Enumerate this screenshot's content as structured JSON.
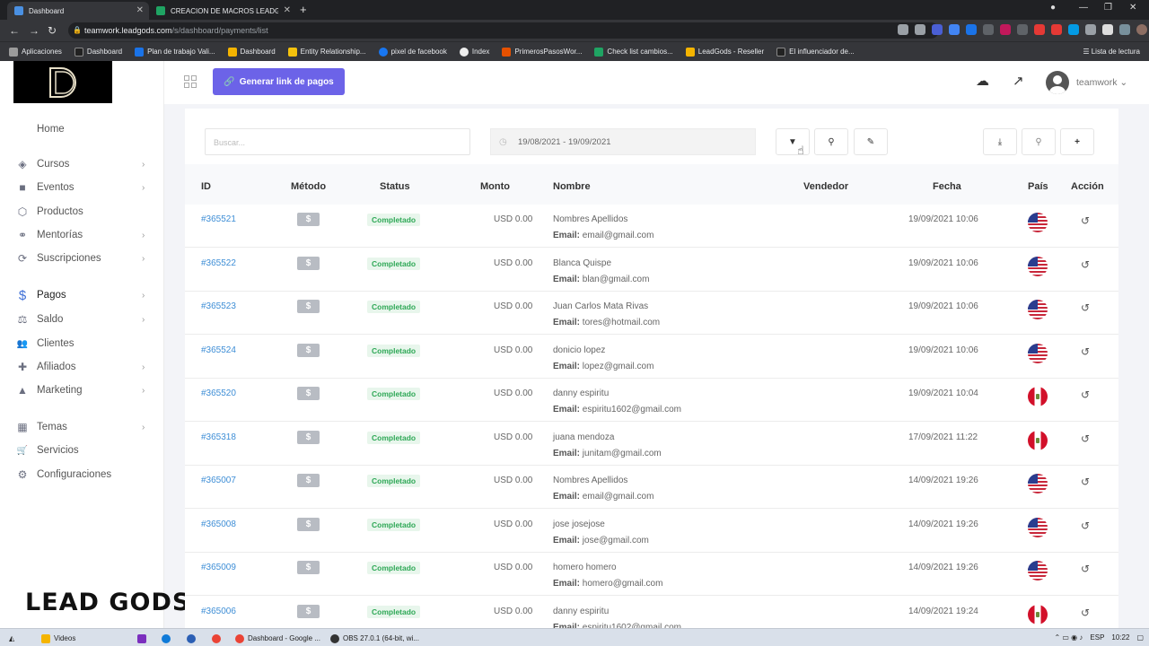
{
  "browser": {
    "tabs": [
      {
        "title": "Dashboard",
        "active": true,
        "color": "#4a90e2"
      },
      {
        "title": "CREACION DE MACROS LEADGO...",
        "active": false,
        "color": "#1fa463"
      }
    ],
    "url_host": "teamwork.leadgods.com",
    "url_path": "/s/dashboard/payments/list",
    "bookmarks": [
      {
        "label": "Aplicaciones",
        "color": "#9b9b9b"
      },
      {
        "label": "Dashboard",
        "color": "#222222"
      },
      {
        "label": "Plan de trabajo Vali...",
        "color": "#1a73e8"
      },
      {
        "label": "Dashboard",
        "color": "#f4b400"
      },
      {
        "label": "Entity Relationship...",
        "color": "#f4c20d"
      },
      {
        "label": "pixel de facebook",
        "color": "#1877f2"
      },
      {
        "label": "Index",
        "color": "#eeeeee"
      },
      {
        "label": "PrimerosPasosWor...",
        "color": "#e65100"
      },
      {
        "label": "Check list cambios...",
        "color": "#1fa463"
      },
      {
        "label": "LeadGods - Reseller",
        "color": "#f4b400"
      },
      {
        "label": "El influenciador de...",
        "color": "#222222"
      }
    ],
    "reading_list": "Lista de lectura"
  },
  "sidebar": {
    "items": [
      {
        "label": "Home",
        "icon": "home-icon",
        "glyph": "",
        "chevron": false
      },
      {
        "label": "Cursos",
        "icon": "layers-icon",
        "glyph": "◈",
        "chevron": true
      },
      {
        "label": "Eventos",
        "icon": "video-icon",
        "glyph": "■",
        "chevron": true
      },
      {
        "label": "Productos",
        "icon": "box-icon",
        "glyph": "⬡",
        "chevron": false
      },
      {
        "label": "Mentorías",
        "icon": "handshake-icon",
        "glyph": "⚭",
        "chevron": true
      },
      {
        "label": "Suscripciones",
        "icon": "refresh-icon",
        "glyph": "⟳",
        "chevron": true
      },
      {
        "label": "Pagos",
        "icon": "dollar-icon",
        "glyph": "$",
        "chevron": true
      },
      {
        "label": "Saldo",
        "icon": "balance-icon",
        "glyph": "⚖",
        "chevron": true
      },
      {
        "label": "Clientes",
        "icon": "users-icon",
        "glyph": "👥",
        "chevron": false
      },
      {
        "label": "Afiliados",
        "icon": "user-plus-icon",
        "glyph": "✚",
        "chevron": true
      },
      {
        "label": "Marketing",
        "icon": "chart-icon",
        "glyph": "▲",
        "chevron": true
      },
      {
        "label": "Temas",
        "icon": "grid-icon",
        "glyph": "▦",
        "chevron": true
      },
      {
        "label": "Servicios",
        "icon": "cart-icon",
        "glyph": "🛒",
        "chevron": false
      },
      {
        "label": "Configuraciones",
        "icon": "gear-icon",
        "glyph": "⚙",
        "chevron": false
      }
    ],
    "brand": "LEAD GODS"
  },
  "topbar": {
    "pay_link_label": "Generar link de pagos",
    "username": "teamwork"
  },
  "filters": {
    "search_placeholder": "Buscar...",
    "date_range": "19/08/2021 - 19/09/2021"
  },
  "table": {
    "headers": {
      "id": "ID",
      "method": "Método",
      "status": "Status",
      "amount": "Monto",
      "name": "Nombre",
      "seller": "Vendedor",
      "date": "Fecha",
      "country": "País",
      "action": "Acción"
    },
    "email_label": "Email:",
    "rows": [
      {
        "id": "#365521",
        "method": "$",
        "status": "Completado",
        "amount": "USD 0.00",
        "name": "Nombres Apellidos",
        "email": "email@gmail.com",
        "date": "19/09/2021 10:06",
        "country": "us"
      },
      {
        "id": "#365522",
        "method": "$",
        "status": "Completado",
        "amount": "USD 0.00",
        "name": "Blanca Quispe",
        "email": "blan@gmail.com",
        "date": "19/09/2021 10:06",
        "country": "us"
      },
      {
        "id": "#365523",
        "method": "$",
        "status": "Completado",
        "amount": "USD 0.00",
        "name": "Juan Carlos Mata Rivas",
        "email": "tores@hotmail.com",
        "date": "19/09/2021 10:06",
        "country": "us"
      },
      {
        "id": "#365524",
        "method": "$",
        "status": "Completado",
        "amount": "USD 0.00",
        "name": "donicio lopez",
        "email": "lopez@gmail.com",
        "date": "19/09/2021 10:06",
        "country": "us"
      },
      {
        "id": "#365520",
        "method": "$",
        "status": "Completado",
        "amount": "USD 0.00",
        "name": "danny espiritu",
        "email": "espiritu1602@gmail.com",
        "date": "19/09/2021 10:04",
        "country": "pe"
      },
      {
        "id": "#365318",
        "method": "$",
        "status": "Completado",
        "amount": "USD 0.00",
        "name": "juana mendoza",
        "email": "junitam@gmail.com",
        "date": "17/09/2021 11:22",
        "country": "pe"
      },
      {
        "id": "#365007",
        "method": "$",
        "status": "Completado",
        "amount": "USD 0.00",
        "name": "Nombres Apellidos",
        "email": "email@gmail.com",
        "date": "14/09/2021 19:26",
        "country": "us"
      },
      {
        "id": "#365008",
        "method": "$",
        "status": "Completado",
        "amount": "USD 0.00",
        "name": "jose josejose",
        "email": "jose@gmail.com",
        "date": "14/09/2021 19:26",
        "country": "us"
      },
      {
        "id": "#365009",
        "method": "$",
        "status": "Completado",
        "amount": "USD 0.00",
        "name": "homero homero",
        "email": "homero@gmail.com",
        "date": "14/09/2021 19:26",
        "country": "us"
      },
      {
        "id": "#365006",
        "method": "$",
        "status": "Completado",
        "amount": "USD 0.00",
        "name": "danny espiritu",
        "email": "espiritu1602@gmail.com",
        "date": "14/09/2021 19:24",
        "country": "pe"
      }
    ]
  },
  "taskbar": {
    "items": [
      {
        "label": "Videos",
        "color": "#f4b400"
      },
      {
        "label": "",
        "color": "#7b2fbe"
      },
      {
        "label": "",
        "color": "#0f7ad8"
      },
      {
        "label": "",
        "color": "#2b5fb4"
      },
      {
        "label": "",
        "color": "#ea4335"
      },
      {
        "label": "Dashboard - Google ...",
        "color": "#ea4335"
      },
      {
        "label": "OBS 27.0.1 (64-bit, wi...",
        "color": "#333333"
      }
    ],
    "lang": "ESP",
    "time": "10:22"
  },
  "colors": {
    "accent": "#6c63e8",
    "link": "#3e8ed6",
    "success": "#2ea856"
  }
}
